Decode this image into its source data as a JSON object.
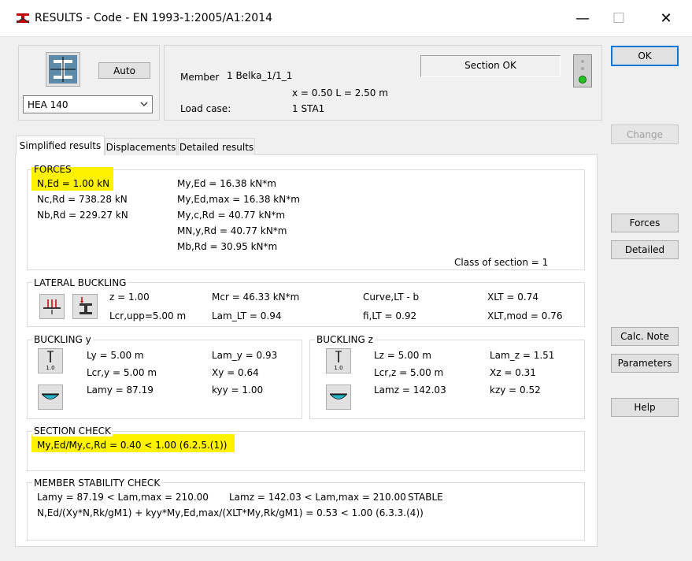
{
  "window": {
    "title": "RESULTS - Code - EN 1993-1:2005/A1:2014",
    "minimize_glyph": "—",
    "maximize_glyph": "☐",
    "close_glyph": "✕"
  },
  "header": {
    "auto_label": "Auto",
    "profile_value": "HEA 140",
    "member_label": "Member",
    "member_value": "1  Belka_1/1_1",
    "position_value": "x = 0.50 L = 2.50 m",
    "load_case_label": "Load case:",
    "load_case_value": "1 STA1",
    "section_status": "Section OK",
    "status_color": "#22c322"
  },
  "buttons": {
    "ok": "OK",
    "change": "Change",
    "forces": "Forces",
    "detailed": "Detailed",
    "calc_note": "Calc. Note",
    "parameters": "Parameters",
    "help": "Help"
  },
  "tabs": [
    "Simplified results",
    "Displacements",
    "Detailed results"
  ],
  "forces": {
    "title": "FORCES",
    "col1": [
      "N,Ed = 1.00 kN",
      "Nc,Rd = 738.28 kN",
      "Nb,Rd = 229.27 kN"
    ],
    "col2": [
      "My,Ed = 16.38 kN*m",
      "My,Ed,max = 16.38 kN*m",
      "My,c,Rd = 40.77 kN*m",
      "MN,y,Rd = 40.77 kN*m",
      "Mb,Rd = 30.95 kN*m"
    ],
    "class_of_section": "Class of section = 1"
  },
  "lateral_buckling": {
    "title": "LATERAL BUCKLING",
    "z": "z = 1.00",
    "lcr_upp": "Lcr,upp=5.00 m",
    "mcr": "Mcr = 46.33 kN*m",
    "lam_lt": "Lam_LT = 0.94",
    "curve_lt": "Curve,LT - b",
    "fi_lt": "fi,LT = 0.92",
    "xlt": "XLT = 0.74",
    "xlt_mod": "XLT,mod = 0.76"
  },
  "buckling_y": {
    "title": "BUCKLING y",
    "ly": "Ly = 5.00 m",
    "lcr_y": "Lcr,y = 5.00 m",
    "lamy": "Lamy = 87.19",
    "lam_y": "Lam_y = 0.93",
    "xy": "Xy = 0.64",
    "kyy": "kyy = 1.00",
    "icon_label": "1.0"
  },
  "buckling_z": {
    "title": "BUCKLING z",
    "lz": "Lz = 5.00 m",
    "lcr_z": "Lcr,z = 5.00 m",
    "lamz": "Lamz = 142.03",
    "lam_z": "Lam_z = 1.51",
    "xz": "Xz = 0.31",
    "kzy": "kzy = 0.52",
    "icon_label": "1.0"
  },
  "section_check": {
    "title": "SECTION CHECK",
    "line": "My,Ed/My,c,Rd = 0.40 < 1.00   (6.2.5.(1))",
    "highlight_color": "#fff200"
  },
  "member_stability": {
    "title": "MEMBER STABILITY CHECK",
    "lamy": "Lamy = 87.19 < Lam,max = 210.00",
    "lamz": "Lamz = 142.03 < Lam,max = 210.00",
    "stable": "STABLE",
    "formula": "N,Ed/(Xy*N,Rk/gM1) + kyy*My,Ed,max/(XLT*My,Rk/gM1) = 0.53 < 1.00   (6.3.3.(4))"
  }
}
